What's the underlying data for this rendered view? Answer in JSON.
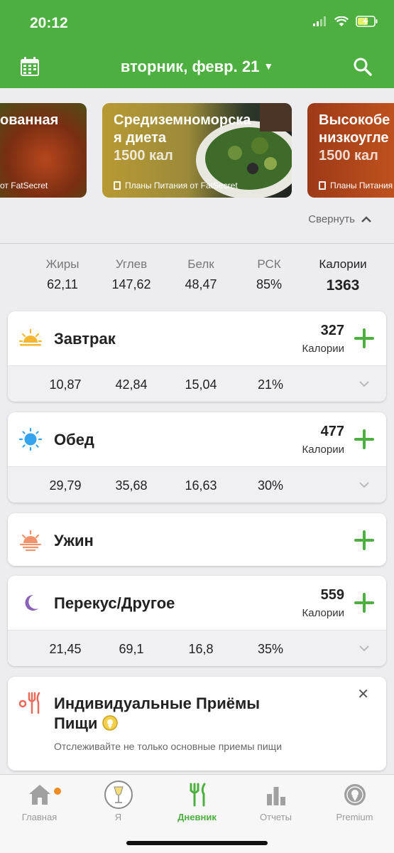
{
  "status": {
    "time": "20:12"
  },
  "header": {
    "date": "вторник, февр. 21"
  },
  "banners": [
    {
      "title": "ованная",
      "kcal": "",
      "source": "от FatSecret"
    },
    {
      "title": "Средиземноморска\nя диета",
      "kcal": "1500 кал",
      "source": "Планы Питания от FatSecret"
    },
    {
      "title": "Высокобе\nнизкоугле",
      "kcal": "1500 кал",
      "source": "Планы Питания"
    }
  ],
  "collapse_label": "Свернуть",
  "totals": {
    "fat": {
      "label": "Жиры",
      "value": "62,11"
    },
    "carbs": {
      "label": "Углев",
      "value": "147,62"
    },
    "protein": {
      "label": "Белк",
      "value": "48,47"
    },
    "rsk": {
      "label": "РСК",
      "value": "85%"
    },
    "kcal": {
      "label": "Калории",
      "value": "1363"
    }
  },
  "meals": {
    "breakfast": {
      "name": "Завтрак",
      "kcal": "327",
      "kcal_label": "Калории",
      "fat": "10,87",
      "carbs": "42,84",
      "protein": "15,04",
      "rsk": "21%"
    },
    "lunch": {
      "name": "Обед",
      "kcal": "477",
      "kcal_label": "Калории",
      "fat": "29,79",
      "carbs": "35,68",
      "protein": "16,63",
      "rsk": "30%"
    },
    "dinner": {
      "name": "Ужин"
    },
    "snack": {
      "name": "Перекус/Другое",
      "kcal": "559",
      "kcal_label": "Калории",
      "fat": "21,45",
      "carbs": "69,1",
      "protein": "16,8",
      "rsk": "35%"
    }
  },
  "custom_meals": {
    "title_line1": "Индивидуальные Приёмы",
    "title_line2": "Пищи",
    "subtitle": "Отслеживайте не только основные приемы пищи"
  },
  "tabs": [
    {
      "label": "Главная",
      "icon": "home-icon"
    },
    {
      "label": "Я",
      "icon": "profile-icon"
    },
    {
      "label": "Дневник",
      "icon": "fork-knife-icon"
    },
    {
      "label": "Отчеты",
      "icon": "bar-chart-icon"
    },
    {
      "label": "Premium",
      "icon": "premium-badge-icon"
    }
  ],
  "colors": {
    "brand": "#4caf3f",
    "badge": "#f08a24"
  }
}
